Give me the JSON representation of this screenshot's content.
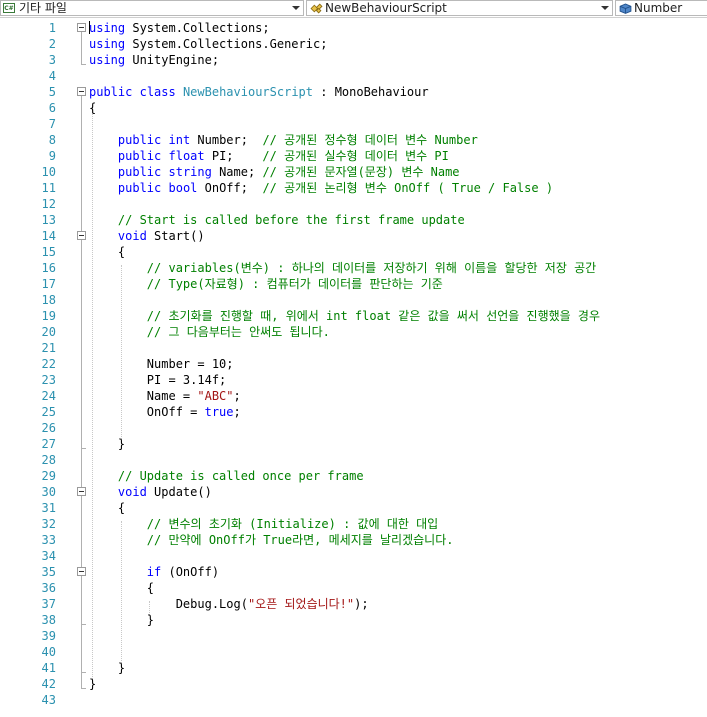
{
  "navbar": {
    "project_dropdown": "기타 파일",
    "class_dropdown": "NewBehaviourScript",
    "member_dropdown": "Number"
  },
  "code": {
    "line_numbers": [
      "1",
      "2",
      "3",
      "4",
      "5",
      "6",
      "7",
      "8",
      "9",
      "10",
      "11",
      "12",
      "13",
      "14",
      "15",
      "16",
      "17",
      "18",
      "19",
      "20",
      "21",
      "22",
      "23",
      "24",
      "25",
      "26",
      "27",
      "28",
      "29",
      "30",
      "31",
      "32",
      "33",
      "34",
      "35",
      "36",
      "37",
      "38",
      "39",
      "40",
      "41",
      "42",
      "43"
    ],
    "lines": [
      [
        {
          "t": "using",
          "c": "kw"
        },
        {
          "t": " System.Collections;",
          "c": "pl"
        }
      ],
      [
        {
          "t": "using",
          "c": "kw"
        },
        {
          "t": " System.Collections.Generic;",
          "c": "pl"
        }
      ],
      [
        {
          "t": "using",
          "c": "kw"
        },
        {
          "t": " UnityEngine;",
          "c": "pl"
        }
      ],
      [],
      [
        {
          "t": "public",
          "c": "kw"
        },
        {
          "t": " ",
          "c": "pl"
        },
        {
          "t": "class",
          "c": "kw"
        },
        {
          "t": " ",
          "c": "pl"
        },
        {
          "t": "NewBehaviourScript",
          "c": "ty"
        },
        {
          "t": " : ",
          "c": "pl"
        },
        {
          "t": "MonoBehaviour",
          "c": "pl"
        }
      ],
      [
        {
          "t": "{",
          "c": "pl"
        }
      ],
      [],
      [
        {
          "t": "    ",
          "c": "pl"
        },
        {
          "t": "public",
          "c": "kw"
        },
        {
          "t": " ",
          "c": "pl"
        },
        {
          "t": "int",
          "c": "kw"
        },
        {
          "t": " Number;  ",
          "c": "pl"
        },
        {
          "t": "// 공개된 정수형 데이터 변수 Number",
          "c": "cm"
        }
      ],
      [
        {
          "t": "    ",
          "c": "pl"
        },
        {
          "t": "public",
          "c": "kw"
        },
        {
          "t": " ",
          "c": "pl"
        },
        {
          "t": "float",
          "c": "kw"
        },
        {
          "t": " PI;    ",
          "c": "pl"
        },
        {
          "t": "// 공개된 실수형 데이터 변수 PI",
          "c": "cm"
        }
      ],
      [
        {
          "t": "    ",
          "c": "pl"
        },
        {
          "t": "public",
          "c": "kw"
        },
        {
          "t": " ",
          "c": "pl"
        },
        {
          "t": "string",
          "c": "kw"
        },
        {
          "t": " Name; ",
          "c": "pl"
        },
        {
          "t": "// 공개된 문자열(문장) 변수 Name",
          "c": "cm"
        }
      ],
      [
        {
          "t": "    ",
          "c": "pl"
        },
        {
          "t": "public",
          "c": "kw"
        },
        {
          "t": " ",
          "c": "pl"
        },
        {
          "t": "bool",
          "c": "kw"
        },
        {
          "t": " OnOff;  ",
          "c": "pl"
        },
        {
          "t": "// 공개된 논리형 변수 OnOff ( True / False )",
          "c": "cm"
        }
      ],
      [],
      [
        {
          "t": "    ",
          "c": "pl"
        },
        {
          "t": "// Start is called before the first frame update",
          "c": "cm"
        }
      ],
      [
        {
          "t": "    ",
          "c": "pl"
        },
        {
          "t": "void",
          "c": "kw"
        },
        {
          "t": " Start()",
          "c": "pl"
        }
      ],
      [
        {
          "t": "    {",
          "c": "pl"
        }
      ],
      [
        {
          "t": "        ",
          "c": "pl"
        },
        {
          "t": "// variables(변수) : 하나의 데이터를 저장하기 위해 이름을 할당한 저장 공간",
          "c": "cm"
        }
      ],
      [
        {
          "t": "        ",
          "c": "pl"
        },
        {
          "t": "// Type(자료형) : 컴퓨터가 데이터를 판단하는 기준",
          "c": "cm"
        }
      ],
      [],
      [
        {
          "t": "        ",
          "c": "pl"
        },
        {
          "t": "// 초기화를 진행할 때, 위에서 int float 같은 값을 써서 선언을 진행했을 경우",
          "c": "cm"
        }
      ],
      [
        {
          "t": "        ",
          "c": "pl"
        },
        {
          "t": "// 그 다음부터는 안써도 됩니다.",
          "c": "cm"
        }
      ],
      [],
      [
        {
          "t": "        Number = 10;",
          "c": "pl"
        }
      ],
      [
        {
          "t": "        PI = 3.14f;",
          "c": "pl"
        }
      ],
      [
        {
          "t": "        Name = ",
          "c": "pl"
        },
        {
          "t": "\"ABC\"",
          "c": "st"
        },
        {
          "t": ";",
          "c": "pl"
        }
      ],
      [
        {
          "t": "        OnOff = ",
          "c": "pl"
        },
        {
          "t": "true",
          "c": "kw"
        },
        {
          "t": ";",
          "c": "pl"
        }
      ],
      [],
      [
        {
          "t": "    }",
          "c": "pl"
        }
      ],
      [],
      [
        {
          "t": "    ",
          "c": "pl"
        },
        {
          "t": "// Update is called once per frame",
          "c": "cm"
        }
      ],
      [
        {
          "t": "    ",
          "c": "pl"
        },
        {
          "t": "void",
          "c": "kw"
        },
        {
          "t": " Update()",
          "c": "pl"
        }
      ],
      [
        {
          "t": "    {",
          "c": "pl"
        }
      ],
      [
        {
          "t": "        ",
          "c": "pl"
        },
        {
          "t": "// 변수의 초기화 (Initialize) : 값에 대한 대입",
          "c": "cm"
        }
      ],
      [
        {
          "t": "        ",
          "c": "pl"
        },
        {
          "t": "// 만약에 OnOff가 True라면, 메세지를 날리겠습니다.",
          "c": "cm"
        }
      ],
      [],
      [
        {
          "t": "        ",
          "c": "pl"
        },
        {
          "t": "if",
          "c": "kw"
        },
        {
          "t": " (OnOff)",
          "c": "pl"
        }
      ],
      [
        {
          "t": "        {",
          "c": "pl"
        }
      ],
      [
        {
          "t": "            Debug.Log(",
          "c": "pl"
        },
        {
          "t": "\"오픈 되었습니다!\"",
          "c": "st"
        },
        {
          "t": ");",
          "c": "pl"
        }
      ],
      [
        {
          "t": "        }",
          "c": "pl"
        }
      ],
      [],
      [],
      [
        {
          "t": "    }",
          "c": "pl"
        }
      ],
      [
        {
          "t": "}",
          "c": "pl"
        }
      ],
      []
    ]
  }
}
